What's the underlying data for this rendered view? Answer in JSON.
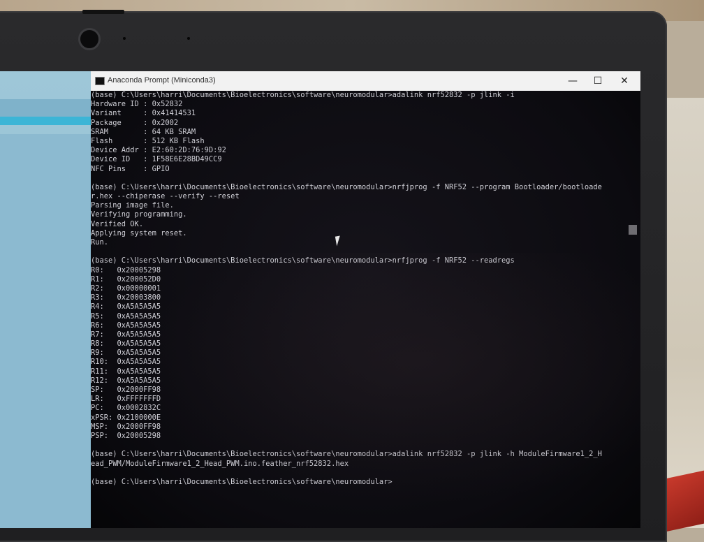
{
  "window": {
    "title": "Anaconda Prompt (Miniconda3)",
    "icon": "console-icon",
    "controls": {
      "minimize": "—",
      "maximize": "☐",
      "close": "✕"
    }
  },
  "terminal": {
    "lines": [
      "(base) C:\\Users\\harri\\Documents\\Bioelectronics\\software\\neuromodular>adalink nrf52832 -p jlink -i",
      "Hardware ID : 0x52832",
      "Variant     : 0x41414531",
      "Package     : 0x2002",
      "SRAM        : 64 KB SRAM",
      "Flash       : 512 KB Flash",
      "Device Addr : E2:60:2D:76:9D:92",
      "Device ID   : 1F58E6E28BD49CC9",
      "NFC Pins    : GPIO",
      "",
      "(base) C:\\Users\\harri\\Documents\\Bioelectronics\\software\\neuromodular>nrfjprog -f NRF52 --program Bootloader/bootloade",
      "r.hex --chiperase --verify --reset",
      "Parsing image file.",
      "Verifying programming.",
      "Verified OK.",
      "Applying system reset.",
      "Run.",
      "",
      "(base) C:\\Users\\harri\\Documents\\Bioelectronics\\software\\neuromodular>nrfjprog -f NRF52 --readregs",
      "R0:   0x20005298",
      "R1:   0x200052D0",
      "R2:   0x00000001",
      "R3:   0x20003800",
      "R4:   0xA5A5A5A5",
      "R5:   0xA5A5A5A5",
      "R6:   0xA5A5A5A5",
      "R7:   0xA5A5A5A5",
      "R8:   0xA5A5A5A5",
      "R9:   0xA5A5A5A5",
      "R10:  0xA5A5A5A5",
      "R11:  0xA5A5A5A5",
      "R12:  0xA5A5A5A5",
      "SP:   0x2000FF98",
      "LR:   0xFFFFFFFD",
      "PC:   0x0002832C",
      "xPSR: 0x2100000E",
      "MSP:  0x2000FF98",
      "PSP:  0x20005298",
      "",
      "(base) C:\\Users\\harri\\Documents\\Bioelectronics\\software\\neuromodular>adalink nrf52832 -p jlink -h ModuleFirmware1_2_H",
      "ead_PWM/ModuleFirmware1_2_Head_PWM.ino.feather_nrf52832.hex",
      "",
      "(base) C:\\Users\\harri\\Documents\\Bioelectronics\\software\\neuromodular>"
    ]
  },
  "colors": {
    "console_text": "#cfcfd6",
    "console_bg": "#0c0b10",
    "titlebar_bg": "#f2f2f2"
  }
}
